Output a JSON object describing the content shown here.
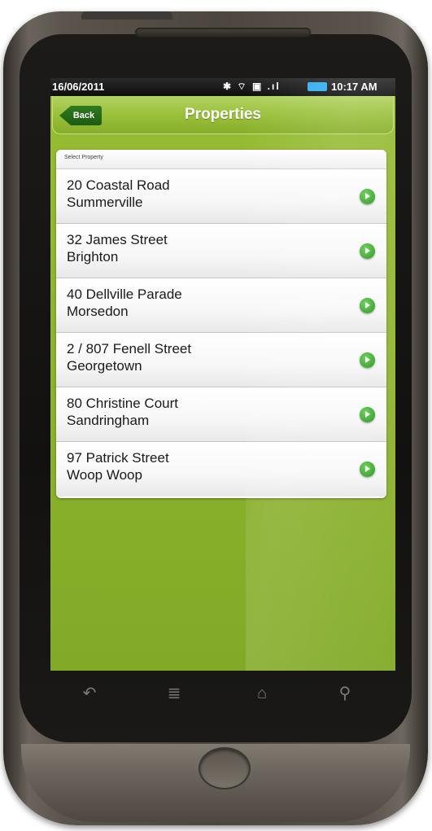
{
  "statusbar": {
    "date": "16/06/2011",
    "icons": "✱ ⌔ ▣ .ıl",
    "time": "10:17 AM",
    "battery_color": "#33aef0"
  },
  "header": {
    "back_label": "Back",
    "title": "Properties"
  },
  "list": {
    "header_label": "Select Property",
    "items": [
      {
        "line1": "20 Coastal Road",
        "line2": "Summerville"
      },
      {
        "line1": "32 James Street",
        "line2": "Brighton"
      },
      {
        "line1": "40 Dellville Parade",
        "line2": "Morsedon"
      },
      {
        "line1": "2 / 807 Fenell Street",
        "line2": "Georgetown"
      },
      {
        "line1": "80 Christine Court",
        "line2": "Sandringham"
      },
      {
        "line1": "97 Patrick Street",
        "line2": "Woop Woop"
      }
    ]
  },
  "navkeys": {
    "back": "↶",
    "menu": "≣",
    "home": "⌂",
    "search": "⚲"
  },
  "colors": {
    "screen_green": "#8eb52d",
    "back_button_green": "#2f7a1f",
    "go_icon_green": "#2fa321"
  },
  "icons": [
    "chevron-right-icon"
  ]
}
